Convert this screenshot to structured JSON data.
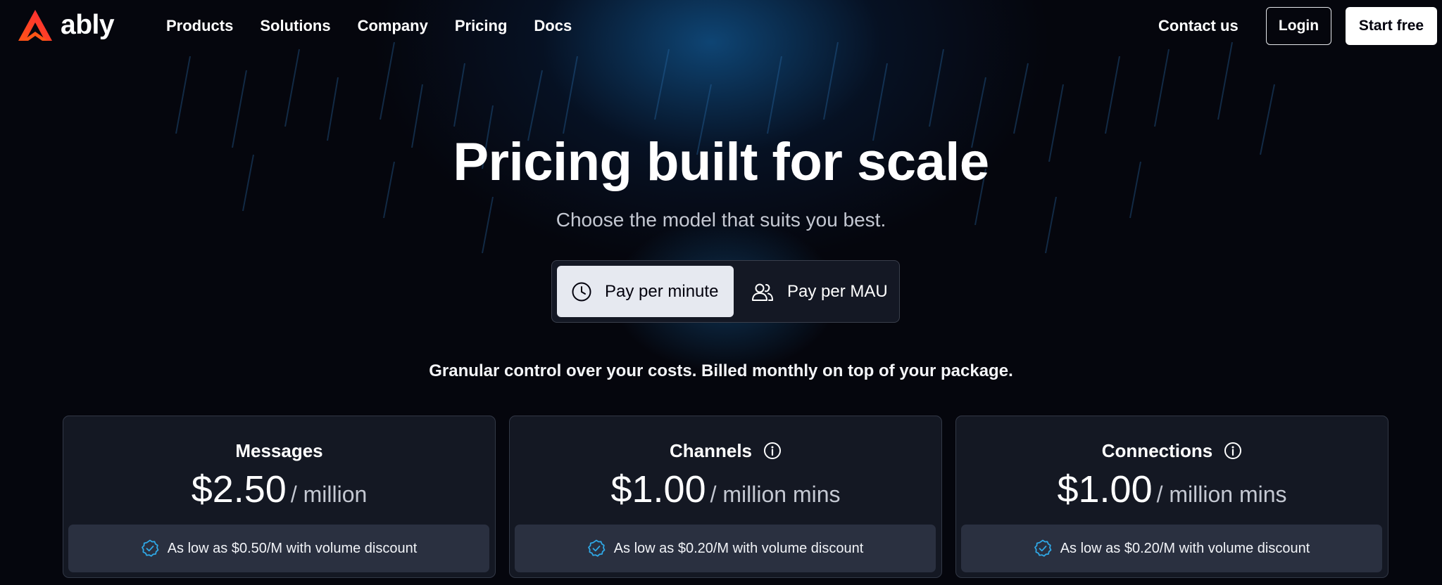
{
  "brand": {
    "name": "ably",
    "accent": "#ff5416"
  },
  "nav": {
    "links": [
      "Products",
      "Solutions",
      "Company",
      "Pricing",
      "Docs"
    ],
    "contact": "Contact us",
    "login": "Login",
    "start": "Start free"
  },
  "hero": {
    "title": "Pricing built for scale",
    "subtitle": "Choose the model that suits you best."
  },
  "toggle": {
    "options": [
      {
        "label": "Pay per minute",
        "icon": "clock-icon",
        "selected": true
      },
      {
        "label": "Pay per MAU",
        "icon": "users-icon",
        "selected": false
      }
    ]
  },
  "tagline": "Granular control over your costs. Billed monthly on top of your package.",
  "cards": [
    {
      "title": "Messages",
      "info": false,
      "price": "$2.50",
      "unit": "/ million",
      "note": "As low as $0.50/M with volume discount"
    },
    {
      "title": "Channels",
      "info": true,
      "price": "$1.00",
      "unit": "/ million mins",
      "note": "As low as $0.20/M with volume discount"
    },
    {
      "title": "Connections",
      "info": true,
      "price": "$1.00",
      "unit": "/ million mins",
      "note": "As low as $0.20/M with volume discount"
    }
  ],
  "colors": {
    "background": "#05060d",
    "card": "#141823",
    "note": "#2a3040",
    "check": "#2fa8e6"
  }
}
